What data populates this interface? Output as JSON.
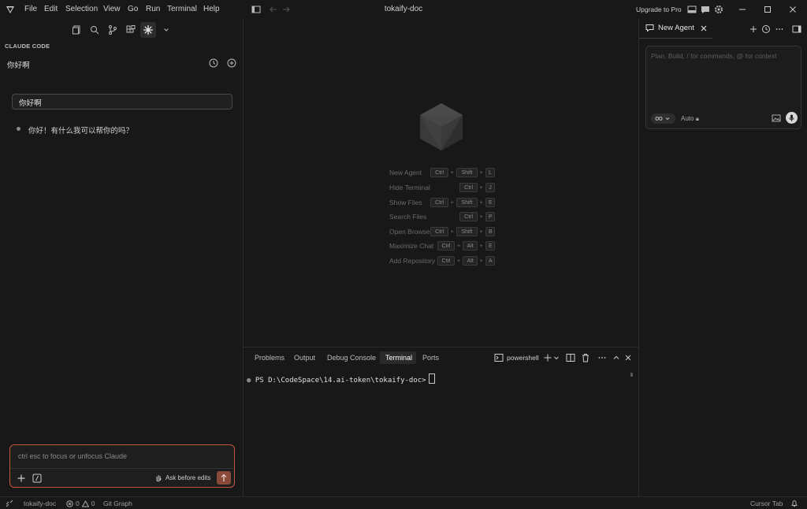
{
  "menu": [
    "File",
    "Edit",
    "Selection",
    "View",
    "Go",
    "Run",
    "Terminal",
    "Help"
  ],
  "window_title": "tokaify-doc",
  "upgrade_label": "Upgrade to Pro",
  "left": {
    "section_title": "CLAUDE CODE",
    "conversation_title": "你好啊",
    "user_message": "你好啊",
    "assistant_reply": "你好！有什么我可以帮你的吗？",
    "input_placeholder": "ctrl esc to focus or unfocus Claude",
    "ask_before_edits": "Ask before edits"
  },
  "shortcuts": [
    {
      "label": "New Agent",
      "keys": [
        "Ctrl",
        "Shift",
        "L"
      ]
    },
    {
      "label": "Hide Terminal",
      "keys": [
        "Ctrl",
        "J"
      ]
    },
    {
      "label": "Show Files",
      "keys": [
        "Ctrl",
        "Shift",
        "E"
      ]
    },
    {
      "label": "Search Files",
      "keys": [
        "Ctrl",
        "P"
      ]
    },
    {
      "label": "Open Browser",
      "keys": [
        "Ctrl",
        "Shift",
        "B"
      ]
    },
    {
      "label": "Maximize Chat",
      "keys": [
        "Ctrl",
        "Alt",
        "E"
      ]
    },
    {
      "label": "Add Repository",
      "keys": [
        "Ctrl",
        "Alt",
        "A"
      ]
    }
  ],
  "terminal": {
    "tabs": [
      "Problems",
      "Output",
      "Debug Console",
      "Terminal",
      "Ports"
    ],
    "active_tab": "Terminal",
    "shell": "powershell",
    "prompt": "PS D:\\CodeSpace\\14.ai-token\\tokaify-doc>"
  },
  "agent": {
    "tab_label": "New Agent",
    "placeholder": "Plan, Build, / for commands, @ for context",
    "mode": "Auto"
  },
  "status": {
    "folder": "tokaify-doc",
    "errors": "0",
    "warnings": "0",
    "git_graph": "Git Graph",
    "cursor_tab": "Cursor Tab"
  },
  "colors": {
    "background": "#181818",
    "accent_input_border": "#c0573c",
    "send_button": "#8a4a3a"
  }
}
